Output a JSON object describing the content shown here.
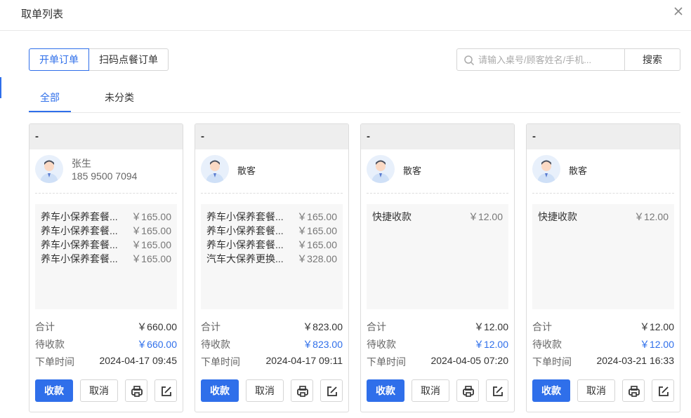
{
  "dialog": {
    "title": "取单列表"
  },
  "order_types": [
    "开单订单",
    "扫码点餐订单"
  ],
  "search": {
    "placeholder": "请输入桌号/顾客姓名/手机...",
    "button": "搜索"
  },
  "tabs": [
    "全部",
    "未分类"
  ],
  "orders": [
    {
      "header": "-",
      "customer_name": "张生",
      "customer_phone": "185 9500 7094",
      "items": [
        {
          "name": "养车小保养套餐...",
          "price": "￥165.00"
        },
        {
          "name": "养车小保养套餐...",
          "price": "￥165.00"
        },
        {
          "name": "养车小保养套餐...",
          "price": "￥165.00"
        },
        {
          "name": "养车小保养套餐...",
          "price": "￥165.00"
        }
      ],
      "total_label": "合计",
      "total": "￥660.00",
      "due_label": "待收款",
      "due": "￥660.00",
      "time_label": "下单时间",
      "time": "2024-04-17 09:45",
      "pay_label": "收款",
      "cancel_label": "取消"
    },
    {
      "header": "-",
      "customer_name": "散客",
      "customer_phone": "",
      "items": [
        {
          "name": "养车小保养套餐...",
          "price": "￥165.00"
        },
        {
          "name": "养车小保养套餐...",
          "price": "￥165.00"
        },
        {
          "name": "养车小保养套餐...",
          "price": "￥165.00"
        },
        {
          "name": "汽车大保养更换...",
          "price": "￥328.00"
        }
      ],
      "total_label": "合计",
      "total": "￥823.00",
      "due_label": "待收款",
      "due": "￥823.00",
      "time_label": "下单时间",
      "time": "2024-04-17 09:11",
      "pay_label": "收款",
      "cancel_label": "取消"
    },
    {
      "header": "-",
      "customer_name": "散客",
      "customer_phone": "",
      "items": [
        {
          "name": "快捷收款",
          "price": "￥12.00"
        }
      ],
      "total_label": "合计",
      "total": "￥12.00",
      "due_label": "待收款",
      "due": "￥12.00",
      "time_label": "下单时间",
      "time": "2024-04-05 07:20",
      "pay_label": "收款",
      "cancel_label": "取消"
    },
    {
      "header": "-",
      "customer_name": "散客",
      "customer_phone": "",
      "items": [
        {
          "name": "快捷收款",
          "price": "￥12.00"
        }
      ],
      "total_label": "合计",
      "total": "￥12.00",
      "due_label": "待收款",
      "due": "￥12.00",
      "time_label": "下单时间",
      "time": "2024-03-21 16:33",
      "pay_label": "收款",
      "cancel_label": "取消"
    }
  ],
  "icons": {
    "close": "close-icon",
    "search": "search-icon",
    "avatar": "user-avatar-icon",
    "print": "print-icon",
    "edit": "edit-icon"
  },
  "colors": {
    "accent": "#2f6fea",
    "card_header_bg": "#eeeeee",
    "items_bg": "#f7f7f7"
  }
}
